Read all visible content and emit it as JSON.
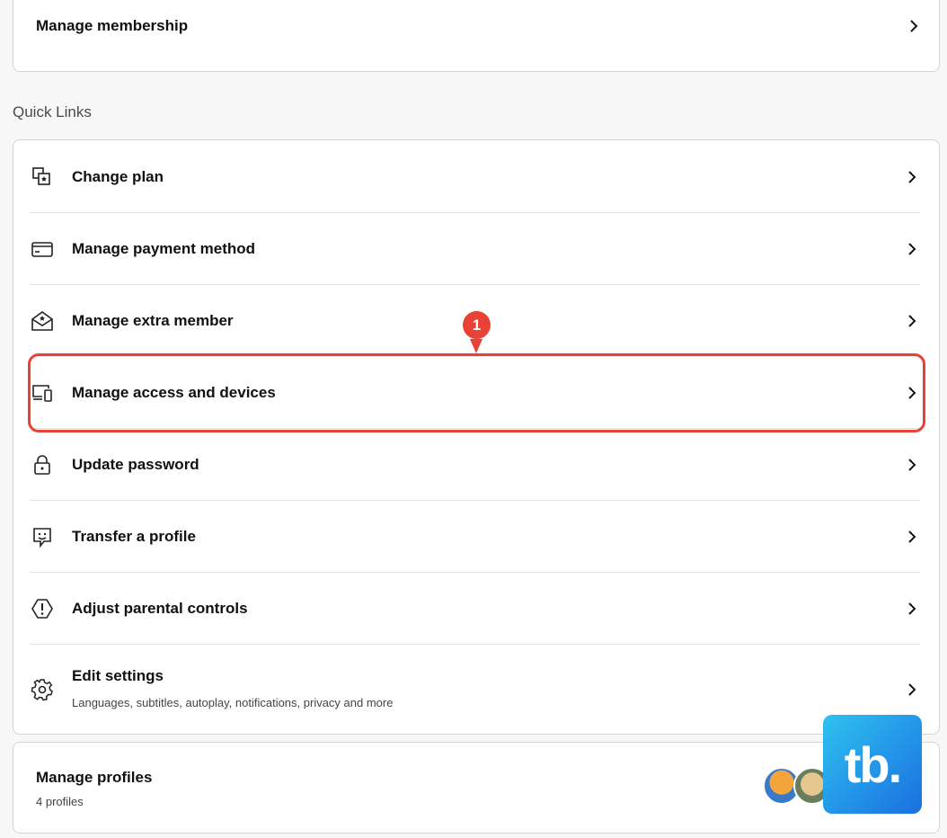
{
  "membership": {
    "label": "Manage membership"
  },
  "quick_links": {
    "title": "Quick Links",
    "items": [
      {
        "label": "Change plan",
        "icon": "change-plan-icon"
      },
      {
        "label": "Manage payment method",
        "icon": "credit-card-icon"
      },
      {
        "label": "Manage extra member",
        "icon": "envelope-star-icon"
      },
      {
        "label": "Manage access and devices",
        "icon": "devices-icon"
      },
      {
        "label": "Update password",
        "icon": "lock-icon"
      },
      {
        "label": "Transfer a profile",
        "icon": "transfer-profile-icon"
      },
      {
        "label": "Adjust parental controls",
        "icon": "parental-controls-icon"
      },
      {
        "label": "Edit settings",
        "sub": "Languages, subtitles, autoplay, notifications, privacy and more",
        "icon": "gear-icon"
      }
    ]
  },
  "profiles": {
    "label": "Manage profiles",
    "sub": "4 profiles"
  },
  "annotation": {
    "step": "1",
    "color": "#e84136"
  },
  "watermark": {
    "text": "tb."
  }
}
